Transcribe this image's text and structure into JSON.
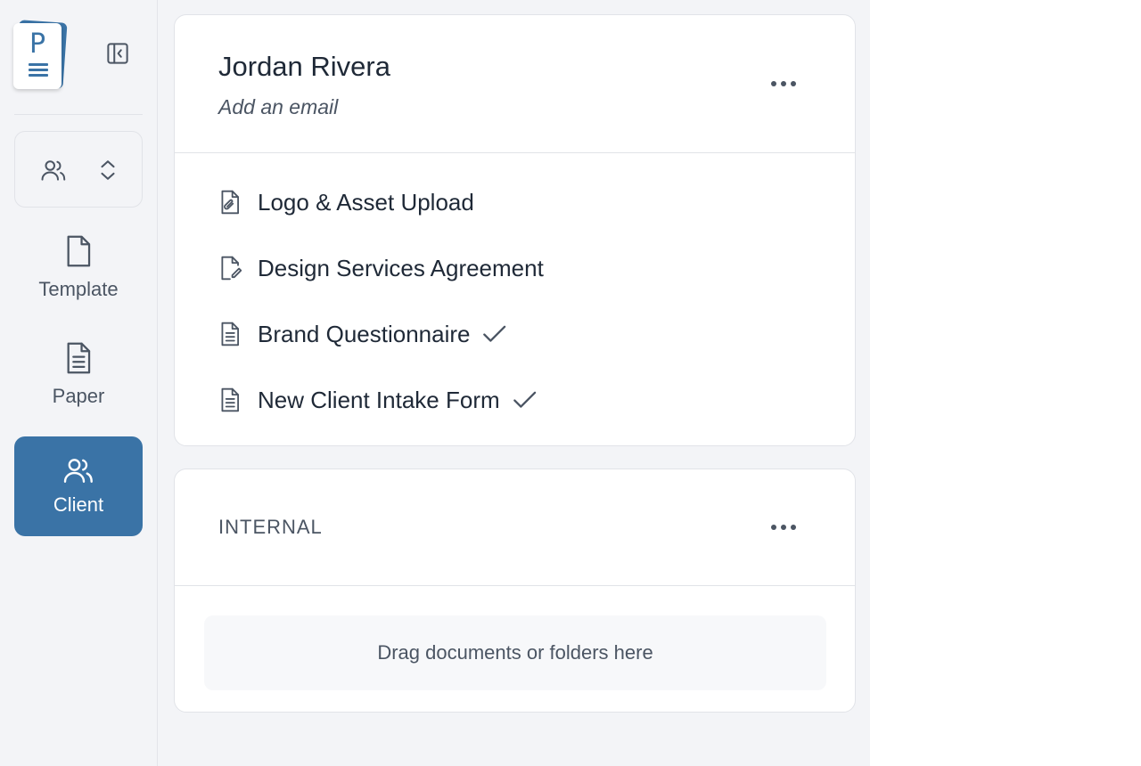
{
  "sidebar": {
    "logo_letter": "P",
    "nav": {
      "template_label": "Template",
      "paper_label": "Paper",
      "client_label": "Client"
    }
  },
  "client_card": {
    "name": "Jordan Rivera",
    "email_placeholder": "Add an email",
    "documents": [
      {
        "title": "Logo & Asset Upload",
        "icon": "file-upload-icon",
        "completed": false
      },
      {
        "title": "Design Services Agreement",
        "icon": "file-signature-icon",
        "completed": false
      },
      {
        "title": "Brand Questionnaire",
        "icon": "file-text-icon",
        "completed": true
      },
      {
        "title": "New Client Intake Form",
        "icon": "file-text-icon",
        "completed": true
      }
    ]
  },
  "internal_card": {
    "label": "INTERNAL",
    "dropzone_text": "Drag documents or folders here"
  },
  "colors": {
    "accent": "#3a73a6",
    "background": "#f3f4f7",
    "text": "#1f2937",
    "muted": "#4b5563"
  }
}
